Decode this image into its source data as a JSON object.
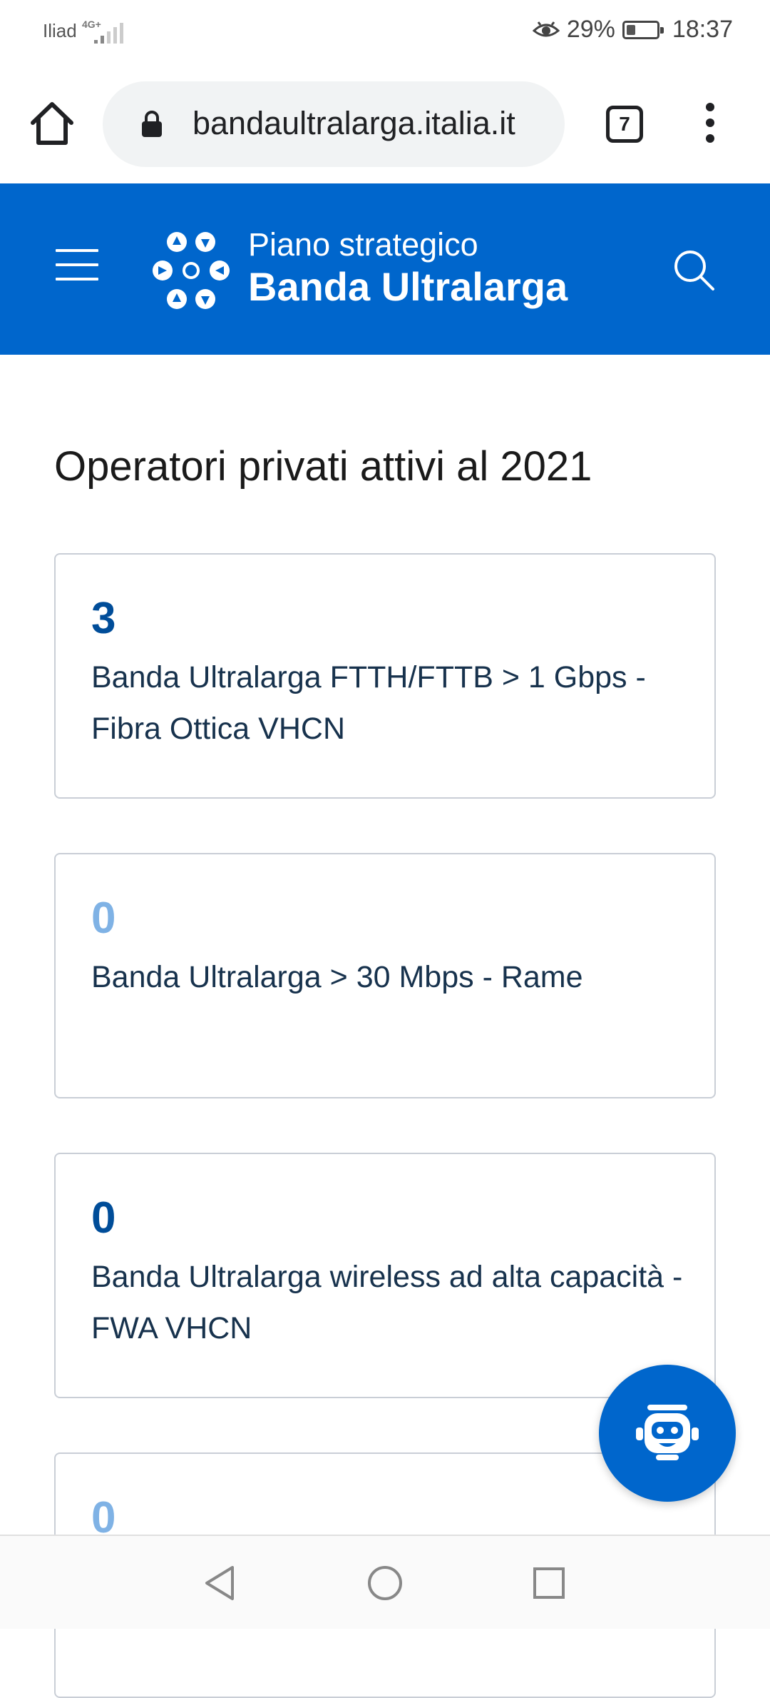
{
  "status_bar": {
    "carrier": "Iliad",
    "network_type": "4G+",
    "battery_percent": "29%",
    "battery_level": 0.29,
    "time": "18:37"
  },
  "browser": {
    "url": "bandaultralarga.italia.it",
    "tab_count": "7"
  },
  "site_header": {
    "subtitle": "Piano strategico",
    "title": "Banda Ultralarga",
    "brand_color": "#0066cc"
  },
  "main": {
    "section_title": "Operatori privati attivi al 2021",
    "cards": [
      {
        "number": "3",
        "number_color": "#004d99",
        "label": "Banda Ultralarga FTTH/FTTB > 1 Gbps - Fibra Ottica VHCN"
      },
      {
        "number": "0",
        "number_color": "#7fb2e5",
        "label": "Banda Ultralarga > 30 Mbps - Rame"
      },
      {
        "number": "0",
        "number_color": "#004d99",
        "label": "Banda Ultralarga wireless ad alta capacità - FWA VHCN"
      },
      {
        "number": "0",
        "number_color": "#7fb2e5",
        "label": ""
      }
    ]
  },
  "icons": {
    "fab": "chatbot-icon",
    "nav_back": "back-triangle-icon",
    "nav_home": "home-circle-icon",
    "nav_recent": "recent-square-icon"
  }
}
